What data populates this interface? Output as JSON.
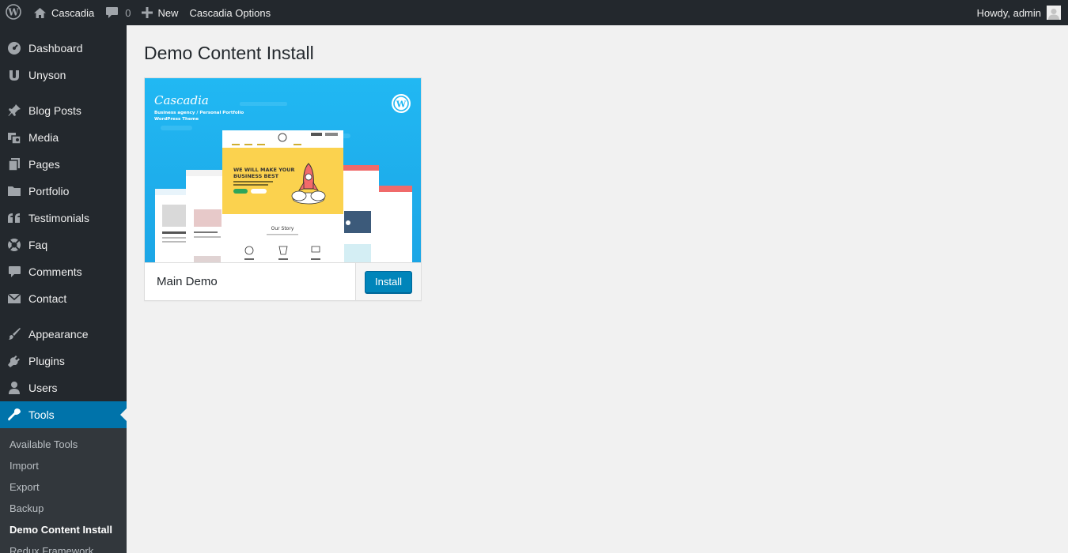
{
  "adminbar": {
    "site_name": "Cascadia",
    "comments_count": "0",
    "new_label": "New",
    "options_label": "Cascadia Options",
    "greeting": "Howdy, admin"
  },
  "sidebar": {
    "items": [
      {
        "label": "Dashboard",
        "icon": "dashboard-icon"
      },
      {
        "label": "Unyson",
        "icon": "unyson-icon"
      },
      {
        "label": "Blog Posts",
        "icon": "pin-icon"
      },
      {
        "label": "Media",
        "icon": "media-icon"
      },
      {
        "label": "Pages",
        "icon": "pages-icon"
      },
      {
        "label": "Portfolio",
        "icon": "folder-icon"
      },
      {
        "label": "Testimonials",
        "icon": "quote-icon"
      },
      {
        "label": "Faq",
        "icon": "lifebuoy-icon"
      },
      {
        "label": "Comments",
        "icon": "comment-icon"
      },
      {
        "label": "Contact",
        "icon": "envelope-icon"
      },
      {
        "label": "Appearance",
        "icon": "brush-icon"
      },
      {
        "label": "Plugins",
        "icon": "plug-icon"
      },
      {
        "label": "Users",
        "icon": "user-icon"
      },
      {
        "label": "Tools",
        "icon": "wrench-icon"
      }
    ],
    "submenu": [
      "Available Tools",
      "Import",
      "Export",
      "Backup",
      "Demo Content Install",
      "Redux Framework"
    ]
  },
  "main": {
    "title": "Demo Content Install",
    "demo": {
      "name": "Main Demo",
      "install_label": "Install",
      "preview": {
        "brand": "Cascadia",
        "tagline_1": "Business agency / Personal Portfolio",
        "tagline_2": "WordPress Theme",
        "hero_1": "WE WILL MAKE YOUR",
        "hero_2": "BUSINESS BEST",
        "section": "Our Story"
      }
    }
  },
  "colors": {
    "adminbar_bg": "#23282d",
    "sidebar_bg": "#23282d",
    "submenu_bg": "#32373c",
    "active_bg": "#0073aa",
    "button_bg": "#0085ba",
    "preview_bg": "#28b4ee",
    "hero_yellow": "#fbd24e"
  }
}
